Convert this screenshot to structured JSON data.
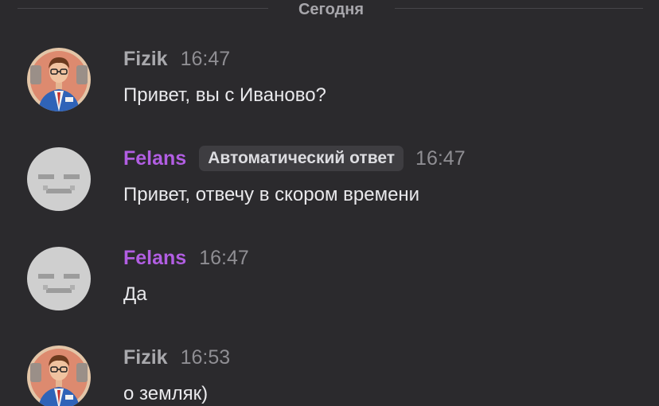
{
  "date_divider": {
    "label": "Сегодня"
  },
  "colors": {
    "background": "#2b2a2d",
    "fizik_name": "#a9a9ad",
    "felans_name": "#b25ee3",
    "message_text": "#e9e9ec",
    "timestamp": "#8f8e93"
  },
  "messages": [
    {
      "author": "Fizik",
      "time": "16:47",
      "text": "Привет, вы с Иваново?",
      "avatar_icon": "illustrated-man-avatar-icon"
    },
    {
      "author": "Felans",
      "badge": "Автоматический ответ",
      "time": "16:47",
      "text": "Привет, отвечу в скором времени",
      "avatar_icon": "default-gray-avatar-icon"
    },
    {
      "author": "Felans",
      "time": "16:47",
      "text": "Да",
      "avatar_icon": "default-gray-avatar-icon"
    },
    {
      "author": "Fizik",
      "time": "16:53",
      "text": "о земляк)",
      "avatar_icon": "illustrated-man-avatar-icon"
    }
  ]
}
